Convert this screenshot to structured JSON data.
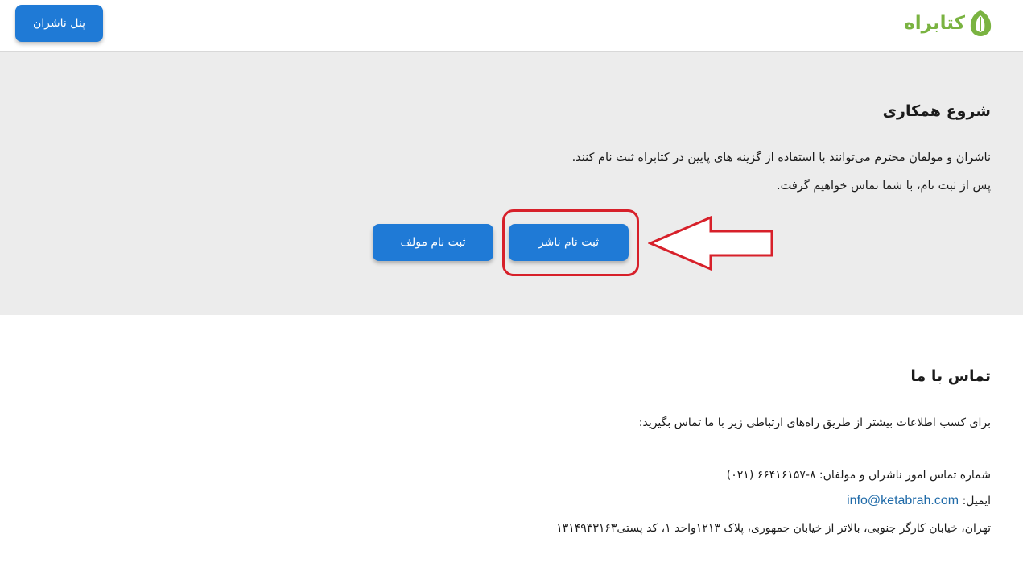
{
  "header": {
    "logo_text": "کتابراه",
    "panel_button_label": "پنل ناشران"
  },
  "cooperation": {
    "title": "شروع همکاری",
    "description_line1": "ناشران و مولفان محترم می‌توانند با استفاده از گزینه های پایین در کتابراه ثبت نام کنند.",
    "description_line2": "پس از ثبت نام، با شما تماس خواهیم گرفت.",
    "register_publisher_label": "ثبت نام ناشر",
    "register_author_label": "ثبت نام مولف"
  },
  "contact": {
    "title": "تماس با ما",
    "intro": "برای کسب اطلاعات بیشتر از طریق راه‌های ارتباطی زیر با ما تماس بگیرید:",
    "phone_text": "شماره تماس امور ناشران و مولفان: ۸-۶۶۴۱۶۱۵۷ (۰۲۱)",
    "email_label": "ایمیل:",
    "email_value": "info@ketabrah.com",
    "address_text": "تهران، خیابان کارگر جنوبی، بالاتر از خیابان جمهوری، پلاک ۱۲۱۳واحد ۱، کد پستی۱۳۱۴۹۳۳۱۶۳"
  },
  "colors": {
    "brand_green": "#7ab341",
    "button_blue": "#1f7ad6",
    "annotation_red": "#d7202a",
    "section_gray": "#ececec"
  },
  "icons": {
    "logo": "book-leaf-icon",
    "annotation_arrow": "arrow-left-icon"
  }
}
